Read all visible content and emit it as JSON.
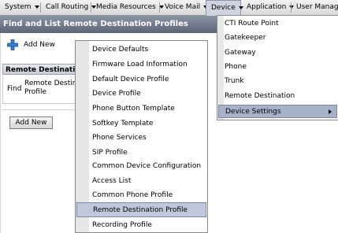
{
  "menubar": {
    "items": [
      {
        "label": "System"
      },
      {
        "label": "Call Routing"
      },
      {
        "label": "Media Resources"
      },
      {
        "label": "Voice Mail"
      },
      {
        "label": "Device"
      },
      {
        "label": "Application"
      },
      {
        "label": "User Managem"
      }
    ]
  },
  "page": {
    "title": "Find and List Remote Destination Profiles",
    "add_new_link": "Add New",
    "section_header": "Remote Destinati",
    "find_label": "Find",
    "find_target": "Remote Destin Profile",
    "add_new_button": "Add New"
  },
  "device_menu": {
    "items": [
      {
        "label": "CTI Route Point"
      },
      {
        "label": "Gatekeeper"
      },
      {
        "label": "Gateway"
      },
      {
        "label": "Phone"
      },
      {
        "label": "Trunk"
      },
      {
        "label": "Remote Destination"
      },
      {
        "label": "Device Settings"
      }
    ]
  },
  "settings_menu": {
    "items": [
      {
        "label": "Device Defaults"
      },
      {
        "label": "Firmware Load Information"
      },
      {
        "label": "Default Device Profile"
      },
      {
        "label": "Device Profile"
      },
      {
        "label": "Phone Button Template"
      },
      {
        "label": "Softkey Template"
      },
      {
        "label": "Phone Services"
      },
      {
        "label": "SIP Profile"
      },
      {
        "label": "Common Device Configuration"
      },
      {
        "label": "Access List"
      },
      {
        "label": "Common Phone Profile"
      },
      {
        "label": "Remote Destination Profile"
      },
      {
        "label": "Recording Profile"
      }
    ]
  }
}
